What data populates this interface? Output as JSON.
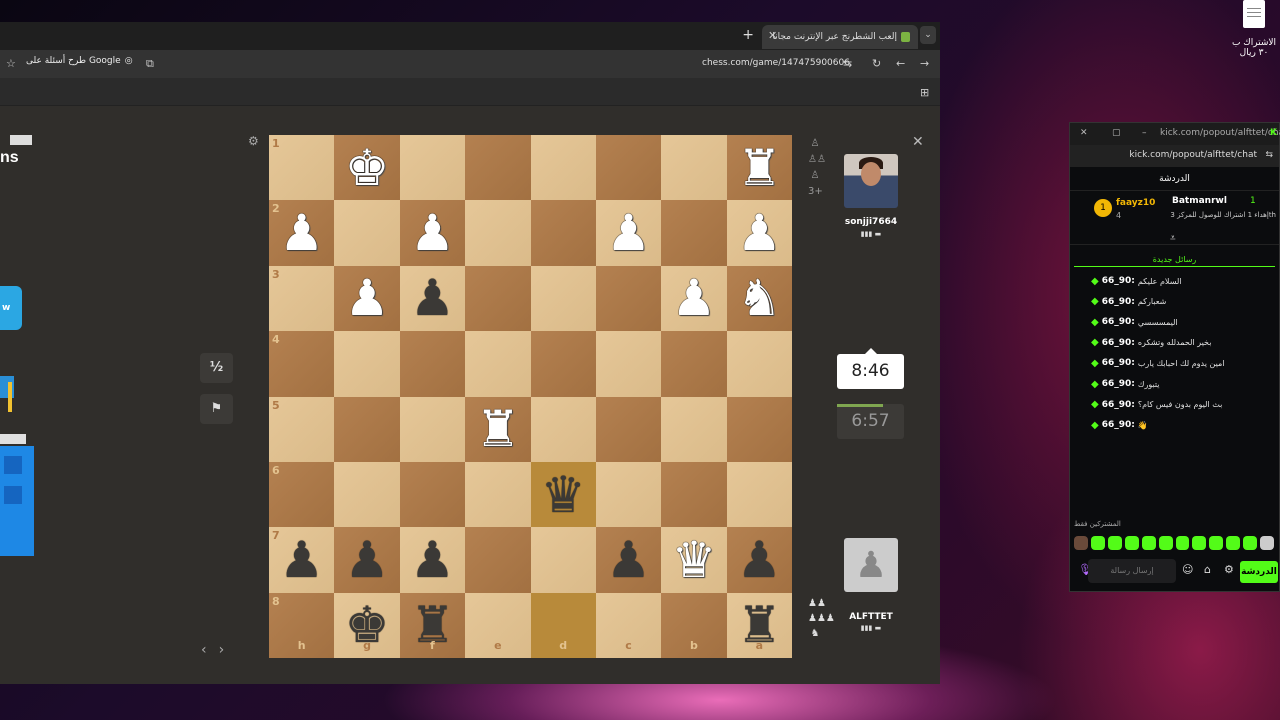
{
  "desktop": {
    "icon_label": "الاشتراك ب ٣٠ ريال"
  },
  "browser": {
    "tab_title": "إلعب الشطرنج عبر الإنترنت مجانا",
    "url": "chess.com/game/147475900606",
    "google_button": "طرح أسئلة على Google"
  },
  "left_page": {
    "title_fragment": "ns",
    "button_fragment": "w"
  },
  "game": {
    "draw_label": "½",
    "top_player": {
      "name": "sonjji7664",
      "sub": "3+"
    },
    "bottom_player": {
      "name": "ALFTTET"
    },
    "clock_active": "8:46",
    "clock_idle": "6:57",
    "board": [
      [
        {
          "p": "",
          "c": ""
        },
        {
          "p": "♚",
          "c": "w"
        },
        {
          "p": "",
          "c": ""
        },
        {
          "p": "",
          "c": ""
        },
        {
          "p": "",
          "c": ""
        },
        {
          "p": "",
          "c": ""
        },
        {
          "p": "",
          "c": ""
        },
        {
          "p": "♜",
          "c": "w"
        }
      ],
      [
        {
          "p": "♟",
          "c": "w"
        },
        {
          "p": "",
          "c": ""
        },
        {
          "p": "♟",
          "c": "w"
        },
        {
          "p": "",
          "c": ""
        },
        {
          "p": "",
          "c": ""
        },
        {
          "p": "♟",
          "c": "w"
        },
        {
          "p": "",
          "c": ""
        },
        {
          "p": "♟",
          "c": "w"
        }
      ],
      [
        {
          "p": "",
          "c": ""
        },
        {
          "p": "♟",
          "c": "w"
        },
        {
          "p": "♟",
          "c": "b"
        },
        {
          "p": "",
          "c": ""
        },
        {
          "p": "",
          "c": ""
        },
        {
          "p": "",
          "c": ""
        },
        {
          "p": "♟",
          "c": "w"
        },
        {
          "p": "♞",
          "c": "w"
        }
      ],
      [
        {
          "p": "",
          "c": ""
        },
        {
          "p": "",
          "c": ""
        },
        {
          "p": "",
          "c": ""
        },
        {
          "p": "",
          "c": ""
        },
        {
          "p": "",
          "c": ""
        },
        {
          "p": "",
          "c": ""
        },
        {
          "p": "",
          "c": ""
        },
        {
          "p": "",
          "c": ""
        }
      ],
      [
        {
          "p": "",
          "c": ""
        },
        {
          "p": "",
          "c": ""
        },
        {
          "p": "",
          "c": ""
        },
        {
          "p": "♜",
          "c": "w"
        },
        {
          "p": "",
          "c": ""
        },
        {
          "p": "",
          "c": ""
        },
        {
          "p": "",
          "c": ""
        },
        {
          "p": "",
          "c": ""
        }
      ],
      [
        {
          "p": "",
          "c": ""
        },
        {
          "p": "",
          "c": ""
        },
        {
          "p": "",
          "c": ""
        },
        {
          "p": "",
          "c": ""
        },
        {
          "p": "♛",
          "c": "b",
          "hl": true
        },
        {
          "p": "",
          "c": ""
        },
        {
          "p": "",
          "c": ""
        },
        {
          "p": "",
          "c": ""
        }
      ],
      [
        {
          "p": "♟",
          "c": "b"
        },
        {
          "p": "♟",
          "c": "b"
        },
        {
          "p": "♟",
          "c": "b"
        },
        {
          "p": "",
          "c": ""
        },
        {
          "p": "",
          "c": ""
        },
        {
          "p": "♟",
          "c": "b"
        },
        {
          "p": "♛",
          "c": "w"
        },
        {
          "p": "♟",
          "c": "b"
        }
      ],
      [
        {
          "p": "",
          "c": ""
        },
        {
          "p": "♚",
          "c": "b"
        },
        {
          "p": "♜",
          "c": "b"
        },
        {
          "p": "",
          "c": ""
        },
        {
          "p": "",
          "c": "",
          "hl": true
        },
        {
          "p": "",
          "c": ""
        },
        {
          "p": "",
          "c": ""
        },
        {
          "p": "♜",
          "c": "b"
        }
      ]
    ],
    "ranks": [
      "1",
      "2",
      "3",
      "4",
      "5",
      "6",
      "7",
      "8"
    ],
    "files": [
      "h",
      "g",
      "f",
      "e",
      "d",
      "c",
      "b",
      "a"
    ]
  },
  "kick": {
    "title_url": "kick.com/popout/alfttet/cha...",
    "url": "kick.com/popout/alfttet/chat",
    "header": "الدردشة",
    "pinned_user1": "faayz10",
    "pinned_user1_count": "4",
    "pinned_user2": "Batmanrwl",
    "pinned_user2_count": "1",
    "pinned_text": "إهداء 1 اشتراك للوصول للمركز 3th",
    "new_messages": "رسائل جديدة",
    "messages": [
      {
        "user": "66_90:",
        "text": "السلام عليكم"
      },
      {
        "user": "66_90:",
        "text": "شعباركم"
      },
      {
        "user": "66_90:",
        "text": "اليمسسسي"
      },
      {
        "user": "66_90:",
        "text": "بخير الحمدلله وتشكره"
      },
      {
        "user": "66_90:",
        "text": "امين يدوم لك احبابك يارب"
      },
      {
        "user": "66_90:",
        "text": "يتبورك"
      },
      {
        "user": "66_90:",
        "text": "بث اليوم بدون فيس كام؟"
      },
      {
        "user": "66_90:",
        "text": "👋"
      }
    ],
    "subs_only": "المشتركين فقط",
    "input_placeholder": "إرسال رسالة",
    "send_label": "الدردشة"
  }
}
